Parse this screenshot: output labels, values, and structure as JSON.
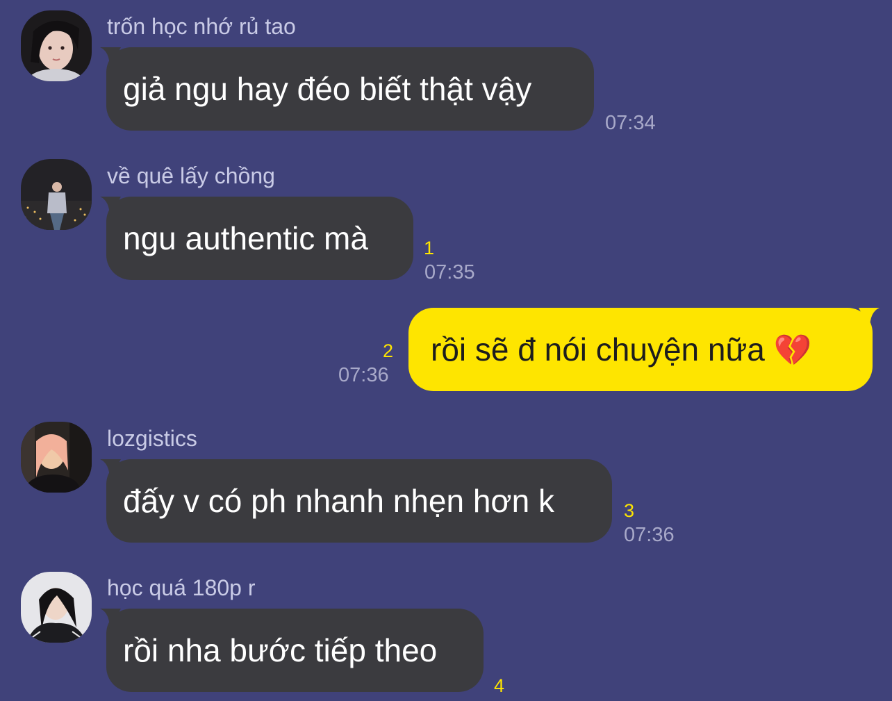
{
  "colors": {
    "background": "#40427a",
    "incoming_bubble": "#3b3b3f",
    "outgoing_bubble": "#fee500",
    "unread_count": "#fee500"
  },
  "messages": [
    {
      "sender": "trốn học nhớ rủ tao",
      "text": "giả ngu hay đéo biết thật vậy",
      "unread": "",
      "time": "07:34"
    },
    {
      "sender": "về quê lấy chồng",
      "text": "ngu authentic mà",
      "unread": "1",
      "time": "07:35"
    },
    {
      "text": "rồi sẽ đ nói chuyện nữa",
      "emoji": "💔",
      "unread": "2",
      "time": "07:36"
    },
    {
      "sender": "lozgistics",
      "text": "đấy v có ph nhanh nhẹn hơn k",
      "unread": "3",
      "time": "07:36"
    },
    {
      "sender": "học quá 180p r",
      "text": "rồi nha bước tiếp theo",
      "unread": "4",
      "time": ""
    }
  ]
}
